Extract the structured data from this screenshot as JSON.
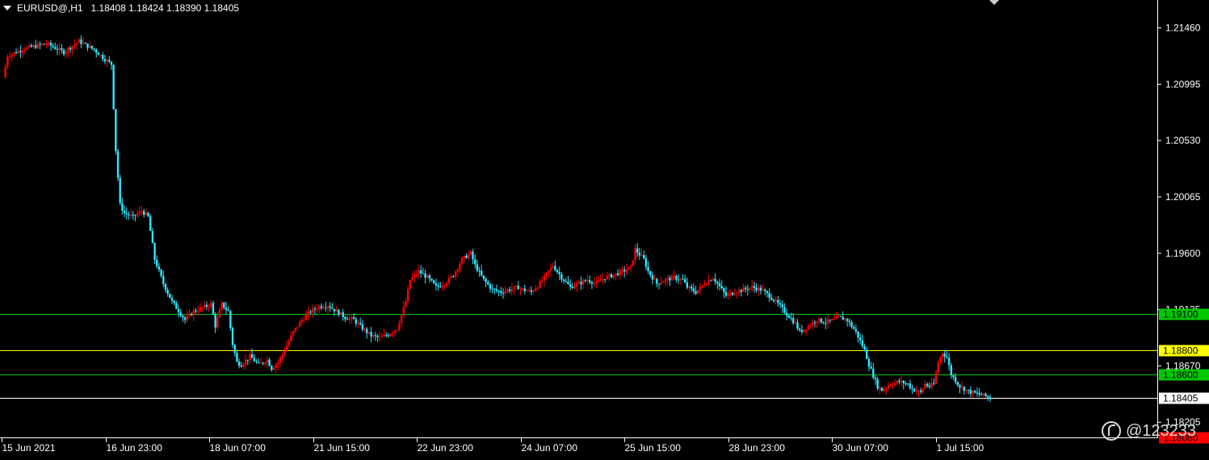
{
  "header": {
    "symbol": "EURUSD@,H1",
    "ohlc": "1.18408 1.18424 1.18390 1.18405"
  },
  "watermark": {
    "text": "@123233",
    "icon": "weibo-icon"
  },
  "colors": {
    "background": "#000000",
    "bull": "#ff0000",
    "bear": "#33e6ff",
    "axis": "#ffffff",
    "level_green": "#00c800",
    "level_yellow": "#ffff00",
    "level_red": "#ff0000",
    "price_line": "#ffffff"
  },
  "chart_data": {
    "type": "candlestick",
    "symbol": "EURUSD@",
    "timeframe": "H1",
    "ylim": [
      1.1808,
      1.2169
    ],
    "y_ticks": [
      "1.21460",
      "1.20995",
      "1.20530",
      "1.20065",
      "1.19600",
      "1.19135",
      "1.18670",
      "1.18205"
    ],
    "x_ticks": [
      "15 Jun 2021",
      "16 Jun 23:00",
      "18 Jun 07:00",
      "21 Jun 15:00",
      "22 Jun 23:00",
      "24 Jun 07:00",
      "25 Jun 15:00",
      "28 Jun 23:00",
      "30 Jun 07:00",
      "1 Jul 15:00"
    ],
    "current_price": "1.18405",
    "levels": [
      {
        "price": 1.191,
        "label": "1.19100",
        "color": "green"
      },
      {
        "price": 1.188,
        "label": "1.18800",
        "color": "yellow"
      },
      {
        "price": 1.186,
        "label": "1.18600",
        "color": "green"
      },
      {
        "price": 1.1808,
        "label": "1.18080",
        "color": "red"
      }
    ],
    "close_path": [
      [
        0,
        1.2105
      ],
      [
        2,
        1.2123
      ],
      [
        10,
        1.2129
      ],
      [
        20,
        1.2133
      ],
      [
        28,
        1.2126
      ],
      [
        35,
        1.2135
      ],
      [
        42,
        1.2128
      ],
      [
        47,
        1.212
      ],
      [
        50,
        1.2116
      ],
      [
        52,
        1.2045
      ],
      [
        54,
        1.2
      ],
      [
        56,
        1.1993
      ],
      [
        60,
        1.199
      ],
      [
        64,
        1.1995
      ],
      [
        67,
        1.199
      ],
      [
        70,
        1.1955
      ],
      [
        74,
        1.1935
      ],
      [
        78,
        1.192
      ],
      [
        82,
        1.191
      ],
      [
        84,
        1.1905
      ],
      [
        88,
        1.1912
      ],
      [
        92,
        1.1915
      ],
      [
        96,
        1.1918
      ],
      [
        98,
        1.19
      ],
      [
        101,
        1.1918
      ],
      [
        104,
        1.1912
      ],
      [
        106,
        1.1885
      ],
      [
        108,
        1.187
      ],
      [
        110,
        1.1868
      ],
      [
        114,
        1.1875
      ],
      [
        118,
        1.1868
      ],
      [
        122,
        1.1872
      ],
      [
        124,
        1.1865
      ],
      [
        127,
        1.187
      ],
      [
        130,
        1.188
      ],
      [
        134,
        1.1895
      ],
      [
        138,
        1.1905
      ],
      [
        142,
        1.1912
      ],
      [
        146,
        1.1916
      ],
      [
        150,
        1.1917
      ],
      [
        154,
        1.1912
      ],
      [
        158,
        1.1907
      ],
      [
        162,
        1.1905
      ],
      [
        166,
        1.1898
      ],
      [
        170,
        1.1892
      ],
      [
        174,
        1.189
      ],
      [
        178,
        1.1893
      ],
      [
        182,
        1.1898
      ],
      [
        186,
        1.192
      ],
      [
        188,
        1.1938
      ],
      [
        192,
        1.1945
      ],
      [
        196,
        1.194
      ],
      [
        200,
        1.1932
      ],
      [
        204,
        1.1935
      ],
      [
        208,
        1.1942
      ],
      [
        212,
        1.1955
      ],
      [
        216,
        1.196
      ],
      [
        218,
        1.195
      ],
      [
        222,
        1.1938
      ],
      [
        226,
        1.193
      ],
      [
        230,
        1.1928
      ],
      [
        234,
        1.193
      ],
      [
        238,
        1.1932
      ],
      [
        240,
        1.193
      ],
      [
        244,
        1.1928
      ],
      [
        248,
        1.1935
      ],
      [
        252,
        1.1945
      ],
      [
        254,
        1.195
      ],
      [
        258,
        1.194
      ],
      [
        262,
        1.1932
      ],
      [
        266,
        1.1935
      ],
      [
        270,
        1.1938
      ],
      [
        274,
        1.1935
      ],
      [
        278,
        1.194
      ],
      [
        282,
        1.1942
      ],
      [
        286,
        1.1945
      ],
      [
        290,
        1.1948
      ],
      [
        292,
        1.1963
      ],
      [
        296,
        1.1955
      ],
      [
        298,
        1.1945
      ],
      [
        302,
        1.1935
      ],
      [
        306,
        1.1938
      ],
      [
        310,
        1.194
      ],
      [
        314,
        1.1938
      ],
      [
        316,
        1.1932
      ],
      [
        320,
        1.1928
      ],
      [
        324,
        1.1935
      ],
      [
        328,
        1.194
      ],
      [
        330,
        1.1935
      ],
      [
        334,
        1.1925
      ],
      [
        338,
        1.1928
      ],
      [
        342,
        1.193
      ],
      [
        346,
        1.1932
      ],
      [
        350,
        1.193
      ],
      [
        354,
        1.1925
      ],
      [
        358,
        1.1918
      ],
      [
        362,
        1.191
      ],
      [
        366,
        1.1902
      ],
      [
        368,
        1.1895
      ],
      [
        372,
        1.19
      ],
      [
        376,
        1.1905
      ],
      [
        380,
        1.1903
      ],
      [
        384,
        1.1905
      ],
      [
        386,
        1.1907
      ],
      [
        390,
        1.1905
      ],
      [
        394,
        1.1895
      ],
      [
        398,
        1.188
      ],
      [
        400,
        1.1868
      ],
      [
        404,
        1.185
      ],
      [
        406,
        1.1847
      ],
      [
        410,
        1.1852
      ],
      [
        414,
        1.1854
      ],
      [
        418,
        1.1852
      ],
      [
        420,
        1.1848
      ],
      [
        424,
        1.1845
      ],
      [
        426,
        1.1852
      ],
      [
        428,
        1.185
      ],
      [
        430,
        1.1852
      ],
      [
        432,
        1.187
      ],
      [
        434,
        1.1878
      ],
      [
        436,
        1.1874
      ],
      [
        438,
        1.186
      ],
      [
        442,
        1.185
      ],
      [
        446,
        1.1846
      ],
      [
        450,
        1.1844
      ],
      [
        454,
        1.1842
      ],
      [
        456,
        1.18405
      ]
    ]
  }
}
